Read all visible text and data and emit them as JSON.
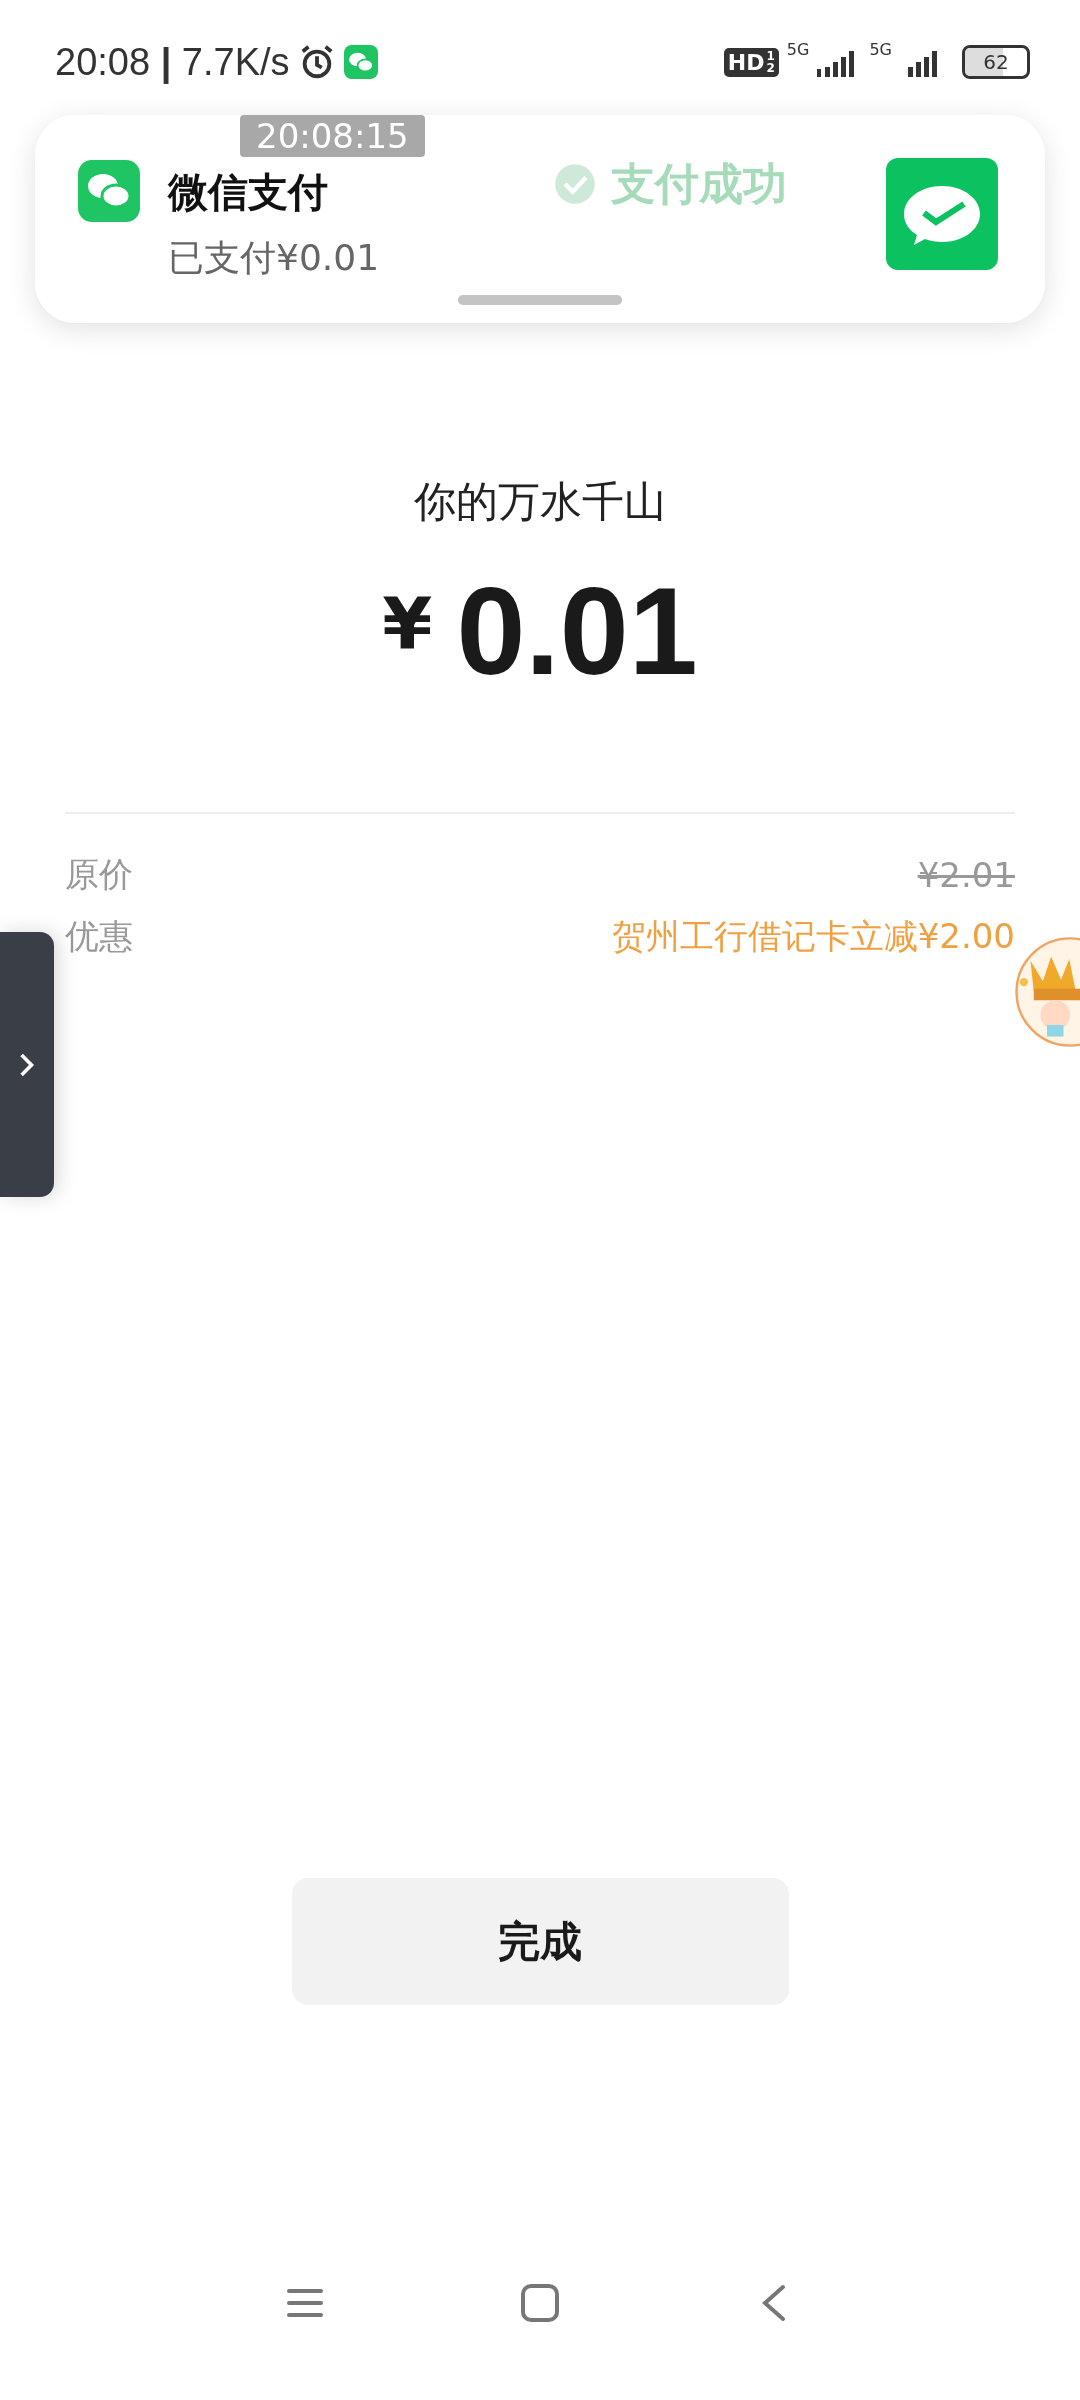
{
  "status_bar": {
    "time": "20:08",
    "speed": "7.7K/s",
    "hd": "HD",
    "hd_sim": "1",
    "hd_sim2": "2",
    "net1": "5G",
    "net2": "5G",
    "battery": "62",
    "separator": "|"
  },
  "page_title": "支付成功",
  "notification": {
    "app": "微信支付",
    "text": "已支付¥0.01",
    "timestamp": "20:08:15"
  },
  "payee": "你的万水千山",
  "currency": "¥",
  "amount": "0.01",
  "details": [
    {
      "label": "原价",
      "value": "¥2.01",
      "kind": "struck"
    },
    {
      "label": "优惠",
      "value": "贺州工行借记卡立减¥2.00",
      "kind": "discount"
    }
  ],
  "done_button": "完成"
}
